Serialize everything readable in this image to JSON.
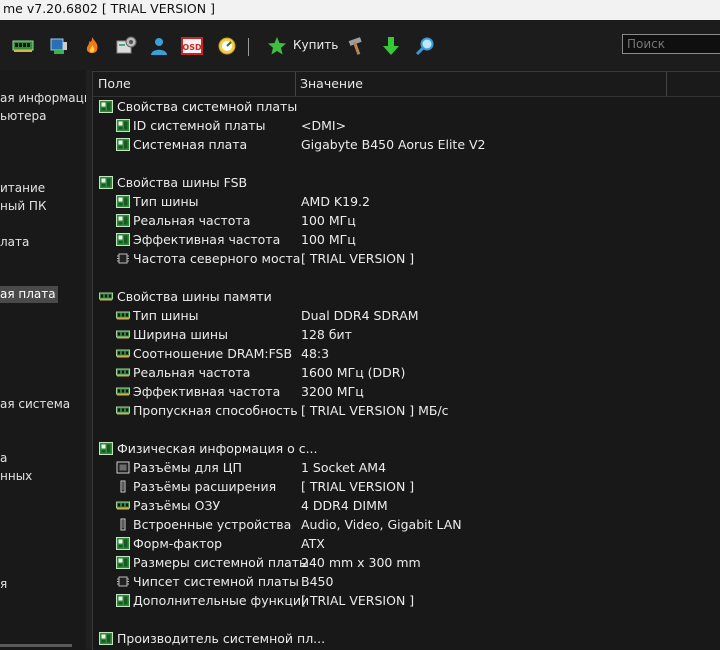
{
  "window": {
    "title": "me v7.20.6802  [ TRIAL VERSION ]"
  },
  "toolbar": {
    "buy_label": "Купить",
    "search_placeholder": "Поиск"
  },
  "sidebar": {
    "items": [
      {
        "label": "ая информация"
      },
      {
        "label": "ьютера"
      },
      {
        "label": "итание"
      },
      {
        "label": "ный ПК"
      },
      {
        "label": "лата"
      },
      {
        "label": "ая плата",
        "selected": true
      },
      {
        "label": "ая система"
      },
      {
        "label": "а"
      },
      {
        "label": "нных"
      },
      {
        "label": "я"
      }
    ]
  },
  "columns": {
    "field": "Поле",
    "value": "Значение"
  },
  "sections": [
    {
      "title": "Свойства системной платы",
      "icon": "motherboard-icon",
      "rows": [
        {
          "field": "ID системной платы",
          "value": "<DMI>",
          "icon": "motherboard-icon"
        },
        {
          "field": "Системная плата",
          "value": "Gigabyte B450 Aorus Elite V2",
          "icon": "motherboard-icon"
        }
      ]
    },
    {
      "title": "Свойства шины FSB",
      "icon": "motherboard-icon",
      "rows": [
        {
          "field": "Тип шины",
          "value": "AMD K19.2",
          "icon": "motherboard-icon"
        },
        {
          "field": "Реальная частота",
          "value": "100 МГц",
          "icon": "motherboard-icon"
        },
        {
          "field": "Эффективная частота",
          "value": "100 МГц",
          "icon": "motherboard-icon"
        },
        {
          "field": "Частота северного моста",
          "value": "[ TRIAL VERSION ]",
          "icon": "chip-icon"
        }
      ]
    },
    {
      "title": "Свойства шины памяти",
      "icon": "memory-icon",
      "rows": [
        {
          "field": "Тип шины",
          "value": "Dual DDR4 SDRAM",
          "icon": "memory-icon"
        },
        {
          "field": "Ширина шины",
          "value": "128 бит",
          "icon": "memory-icon"
        },
        {
          "field": "Соотношение DRAM:FSB",
          "value": "48:3",
          "icon": "memory-icon"
        },
        {
          "field": "Реальная частота",
          "value": "1600 МГц (DDR)",
          "icon": "memory-icon"
        },
        {
          "field": "Эффективная частота",
          "value": "3200 МГц",
          "icon": "memory-icon"
        },
        {
          "field": "Пропускная способность",
          "value": "[ TRIAL VERSION ] МБ/с",
          "icon": "memory-icon"
        }
      ]
    },
    {
      "title": "Физическая информация о с...",
      "icon": "motherboard-icon",
      "rows": [
        {
          "field": "Разъёмы для ЦП",
          "value": "1 Socket AM4",
          "icon": "cpu-socket-icon"
        },
        {
          "field": "Разъёмы расширения",
          "value": "[ TRIAL VERSION ]",
          "icon": "expansion-slot-icon"
        },
        {
          "field": "Разъёмы ОЗУ",
          "value": "4 DDR4 DIMM",
          "icon": "memory-icon"
        },
        {
          "field": "Встроенные устройства",
          "value": "Audio, Video, Gigabit LAN",
          "icon": "expansion-slot-icon"
        },
        {
          "field": "Форм-фактор",
          "value": "ATX",
          "icon": "motherboard-icon"
        },
        {
          "field": "Размеры системной платы",
          "value": "240 mm x 300 mm",
          "icon": "motherboard-icon"
        },
        {
          "field": "Чипсет системной платы",
          "value": "B450",
          "icon": "chip-icon"
        },
        {
          "field": "Дополнительные функции",
          "value": "[ TRIAL VERSION ]",
          "icon": "motherboard-icon"
        }
      ]
    },
    {
      "title": "Производитель системной пл...",
      "icon": "motherboard-icon",
      "rows": []
    }
  ]
}
